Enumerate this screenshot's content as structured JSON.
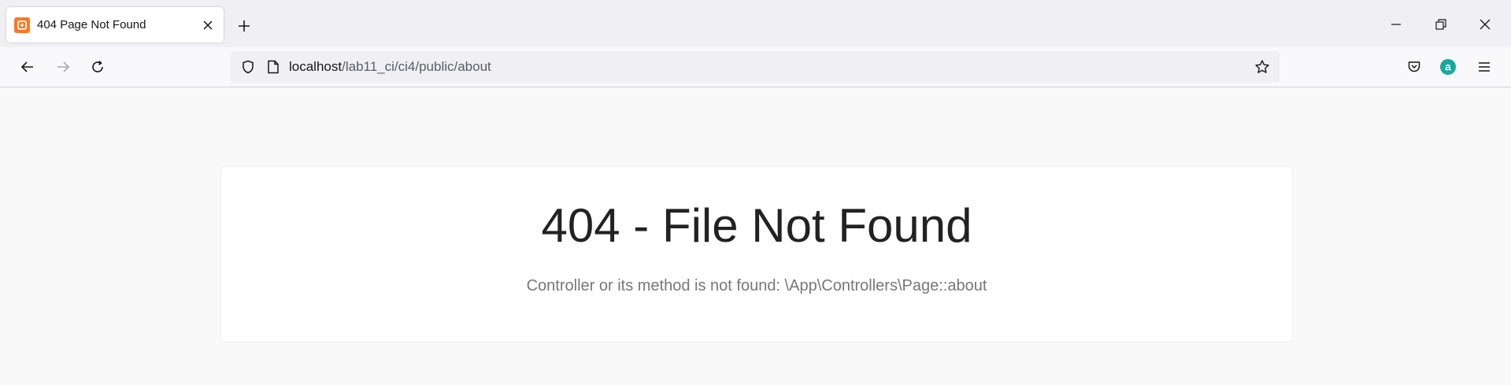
{
  "browser": {
    "tab": {
      "title": "404 Page Not Found",
      "favicon": "codeigniter-icon"
    },
    "url": {
      "host": "localhost",
      "path": "/lab11_ci/ci4/public/about"
    },
    "colors": {
      "favicon": "#fb7a24",
      "account": "#16a89b"
    }
  },
  "page": {
    "heading": "404 - File Not Found",
    "message": "Controller or its method is not found: \\App\\Controllers\\Page::about"
  }
}
